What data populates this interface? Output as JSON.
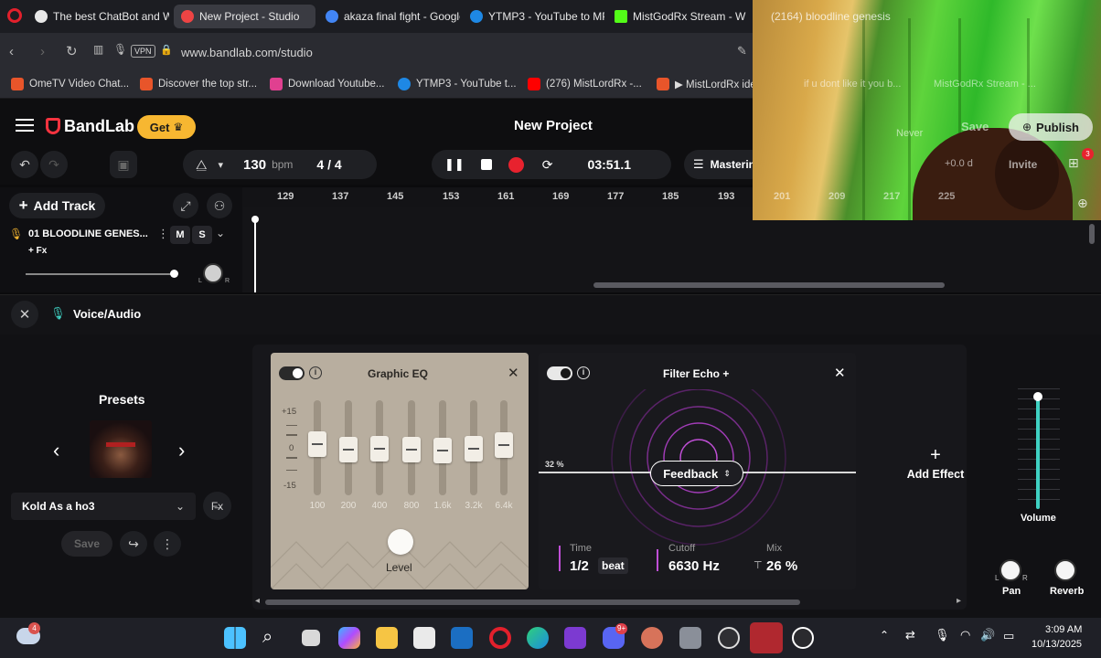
{
  "browser": {
    "tabs": [
      {
        "label": "The best ChatBot and Wid",
        "color": "#e8e8e8"
      },
      {
        "label": "New Project - Studio",
        "color": "#e44"
      },
      {
        "label": "akaza final fight - Google",
        "color": "#4285f4"
      },
      {
        "label": "YTMP3 - YouTube to MP3",
        "color": "#1e88e5"
      },
      {
        "label": "MistGodRx Stream - W",
        "color": "#53fc18"
      },
      {
        "label": "(2164) bloodline genesis",
        "color": "#f00"
      }
    ],
    "url": "www.bandlab.com/studio",
    "vpn_label": "VPN",
    "bookmarks": [
      {
        "label": "OmeTV Video Chat...",
        "color": "#e8552a"
      },
      {
        "label": "Discover the top str...",
        "color": "#e8552a"
      },
      {
        "label": "Download Youtube...",
        "color": "#e04090"
      },
      {
        "label": "YTMP3 - YouTube t...",
        "color": "#1e88e5"
      },
      {
        "label": "(276) MistLordRx -...",
        "color": "#f00"
      },
      {
        "label": "▶ MistLordRx idek...",
        "color": "#e8552a"
      }
    ]
  },
  "app": {
    "logo": "BandLab",
    "get_label": "Get",
    "title": "New Project",
    "publish_label": "Publish",
    "save_label": "Save",
    "invite_label": "Invite"
  },
  "toolbar": {
    "bpm_value": "130",
    "bpm_unit": "bpm",
    "time_signature": "4 / 4",
    "time": "03:51.1",
    "mastering": "Mastering"
  },
  "timeline": {
    "add_track": "Add Track",
    "ticks": [
      "129",
      "137",
      "145",
      "153",
      "161",
      "169",
      "177",
      "185",
      "193",
      "201",
      "209",
      "217",
      "225"
    ],
    "track": {
      "name": "01  BLOODLINE GENES...",
      "mute": "M",
      "solo": "S",
      "fx": "+ Fx",
      "pan_l": "L",
      "pan_r": "R"
    }
  },
  "panel": {
    "title": "Voice/Audio",
    "presets_label": "Presets",
    "preset_name": "Kold As a ho3",
    "save_label": "Save",
    "eq": {
      "title": "Graphic EQ",
      "db_top": "+15",
      "db_mid": "0",
      "db_bot": "-15",
      "bands": [
        "100",
        "200",
        "400",
        "800",
        "1.6k",
        "3.2k",
        "6.4k"
      ],
      "level_label": "Level"
    },
    "echo": {
      "title": "Filter Echo +",
      "percent": "32 %",
      "feedback_label": "Feedback",
      "time_label": "Time",
      "time_value": "1/2",
      "time_unit": "beat",
      "cutoff_label": "Cutoff",
      "cutoff_value": "6630 Hz",
      "mix_label": "Mix",
      "mix_value": "26 %"
    },
    "add_effect": "Add Effect",
    "volume_label": "Volume",
    "pan_label": "Pan",
    "reverb_label": "Reverb",
    "pan_l": "L",
    "pan_r": "R"
  },
  "overlay": {
    "title": "(2164) bloodline genesis",
    "text1": "if u dont like it you b...",
    "text2": "MistGodRx Stream - ...",
    "never": "Never",
    "plus_db": "+0.0 d",
    "badge": "3"
  },
  "taskbar": {
    "badge": "4",
    "discord_badge": "9+",
    "time": "3:09 AM",
    "date": "10/13/2025"
  }
}
